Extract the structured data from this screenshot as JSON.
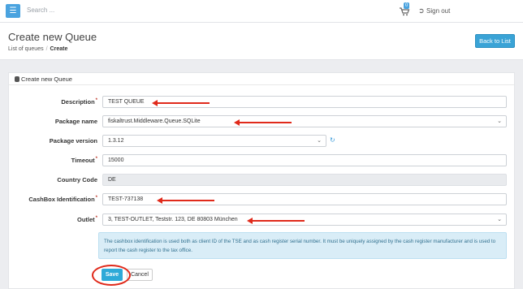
{
  "topbar": {
    "search_placeholder": "Search ...",
    "cart_count": "0",
    "signout_label": "Sign out"
  },
  "header": {
    "title": "Create new Queue",
    "breadcrumb": [
      "List of queues",
      "Create"
    ],
    "back_button": "Back to List"
  },
  "panel": {
    "title": "Create new Queue"
  },
  "form": {
    "description": {
      "label": "Description",
      "required": "*",
      "value": "TEST QUEUE"
    },
    "package_name": {
      "label": "Package name",
      "value": "fiskaltrust.Middleware.Queue.SQLite"
    },
    "package_version": {
      "label": "Package version",
      "value": "1.3.12"
    },
    "timeout": {
      "label": "Timeout",
      "required": "*",
      "value": "15000"
    },
    "country_code": {
      "label": "Country Code",
      "value": "DE"
    },
    "cashbox_id": {
      "label": "CashBox Identification",
      "required": "*",
      "value": "TEST-737138"
    },
    "outlet": {
      "label": "Outlet",
      "required": "*",
      "value": "3, TEST-OUTLET, Teststr. 123, DE 80803 München"
    }
  },
  "info_text": "The cashbox identification is used both as client ID of the TSE and as cash register serial number. It must be uniquely assigned by the cash register manufacturer and is used to report the cash register to the tax office.",
  "actions": {
    "save": "Save",
    "cancel": "Cancel"
  },
  "colors": {
    "accent": "#3aa3d6",
    "annotation": "#e02a1b",
    "info_bg": "#d9edf7"
  }
}
